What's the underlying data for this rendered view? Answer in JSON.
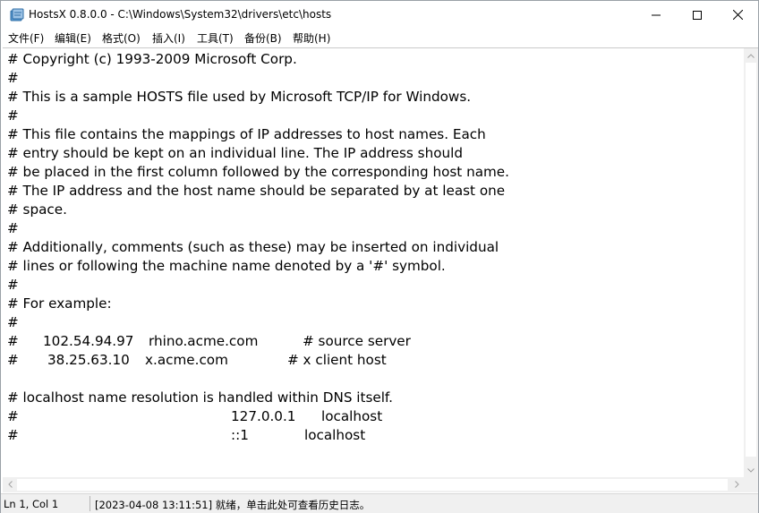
{
  "window": {
    "title": "HostsX 0.8.0.0 - C:\\Windows\\System32\\drivers\\etc\\hosts",
    "icon": "hostsx-app-icon"
  },
  "menu": [
    {
      "label": "文件(F)"
    },
    {
      "label": "编辑(E)"
    },
    {
      "label": "格式(O)"
    },
    {
      "label": "插入(I)"
    },
    {
      "label": "工具(T)"
    },
    {
      "label": "备份(B)"
    },
    {
      "label": "帮助(H)"
    }
  ],
  "editor": {
    "lines": [
      "# Copyright (c) 1993-2009 Microsoft Corp.",
      "#",
      "# This is a sample HOSTS file used by Microsoft TCP/IP for Windows.",
      "#",
      "# This file contains the mappings of IP addresses to host names. Each",
      "# entry should be kept on an individual line. The IP address should",
      "# be placed in the first column followed by the corresponding host name.",
      "# The IP address and the host name should be separated by at least one",
      "# space.",
      "#",
      "# Additionally, comments (such as these) may be inserted on individual",
      "# lines or following the machine name denoted by a '#' symbol.",
      "#",
      "# For example:",
      "#"
    ],
    "example_rows": [
      {
        "hash": "#",
        "ip": "102.54.94.97",
        "host": "rhino.acme.com",
        "comment": "# source server"
      },
      {
        "hash": "#",
        "ip": "38.25.63.10",
        "host": "x.acme.com",
        "comment": "# x client host"
      }
    ],
    "blank_line": "",
    "dns_line": "# localhost name resolution is handled within DNS itself.",
    "local_rows": [
      {
        "hash": "#",
        "ip": "127.0.0.1",
        "host": "localhost"
      },
      {
        "hash": "#",
        "ip": "::1",
        "host": "localhost"
      }
    ]
  },
  "status": {
    "position": "Ln 1, Col 1",
    "message": "[2023-04-08 13:11:51] 就绪，单击此处可查看历史日志。"
  }
}
